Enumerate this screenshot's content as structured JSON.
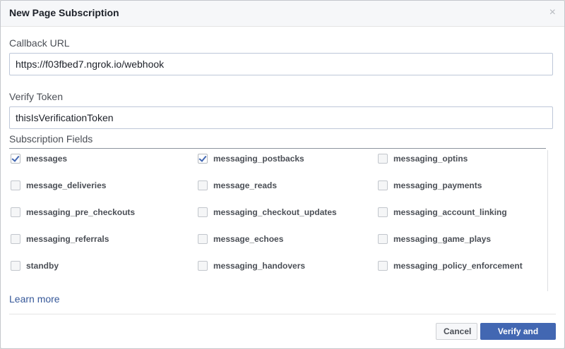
{
  "dialog": {
    "title": "New Page Subscription",
    "close_glyph": "×"
  },
  "callback": {
    "label": "Callback URL",
    "value": "https://f03fbed7.ngrok.io/webhook"
  },
  "verify": {
    "label": "Verify Token",
    "value": "thisIsVerificationToken"
  },
  "fields": {
    "label": "Subscription Fields",
    "items": [
      {
        "label": "messages",
        "checked": true
      },
      {
        "label": "messaging_postbacks",
        "checked": true
      },
      {
        "label": "messaging_optins",
        "checked": false
      },
      {
        "label": "message_deliveries",
        "checked": false
      },
      {
        "label": "message_reads",
        "checked": false
      },
      {
        "label": "messaging_payments",
        "checked": false
      },
      {
        "label": "messaging_pre_checkouts",
        "checked": false
      },
      {
        "label": "messaging_checkout_updates",
        "checked": false
      },
      {
        "label": "messaging_account_linking",
        "checked": false
      },
      {
        "label": "messaging_referrals",
        "checked": false
      },
      {
        "label": "message_echoes",
        "checked": false
      },
      {
        "label": "messaging_game_plays",
        "checked": false
      },
      {
        "label": "standby",
        "checked": false
      },
      {
        "label": "messaging_handovers",
        "checked": false
      },
      {
        "label": "messaging_policy_enforcement",
        "checked": false
      }
    ]
  },
  "learn_more": "Learn more",
  "buttons": {
    "cancel": "Cancel",
    "verify_save": "Verify and Save"
  },
  "colors": {
    "accent": "#4267b2",
    "link": "#365899"
  }
}
